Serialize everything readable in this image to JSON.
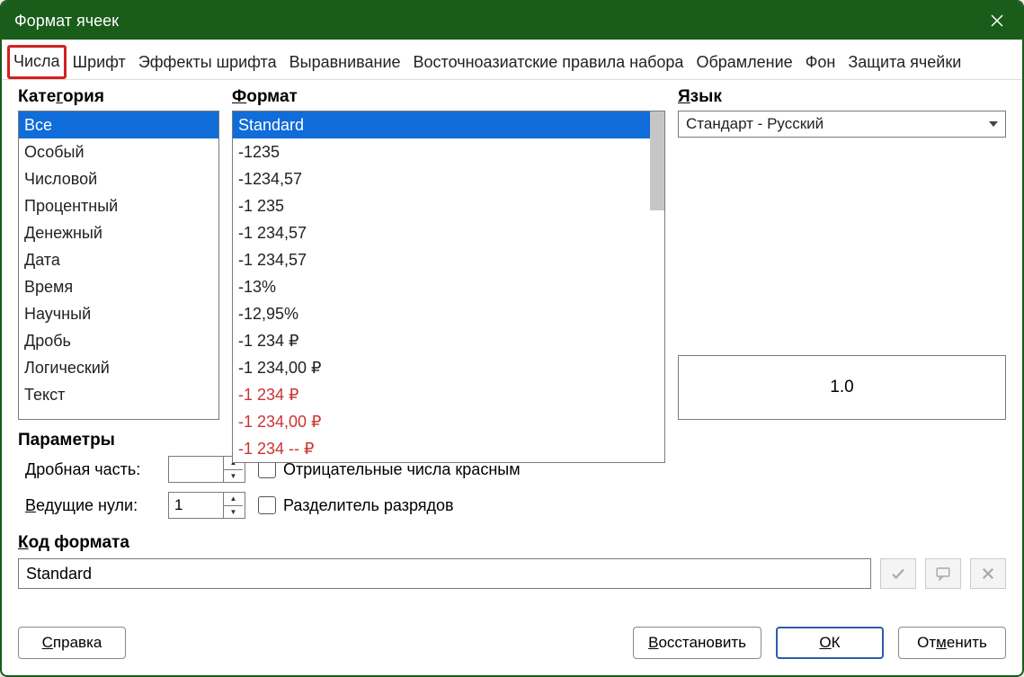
{
  "title": "Формат ячеек",
  "tabs": [
    "Числа",
    "Шрифт",
    "Эффекты шрифта",
    "Выравнивание",
    "Восточноазиатские правила набора",
    "Обрамление",
    "Фон",
    "Защита ячейки"
  ],
  "active_tab": 0,
  "labels": {
    "category": "Категория",
    "format": "Формат",
    "language": "Язык",
    "parameters": "Параметры",
    "decimal": "Дробная часть:",
    "leading": "Ведущие нули:",
    "neg_red": "Отрицательные числа красным",
    "thou_sep": "Разделитель разрядов",
    "format_code": "Код формата"
  },
  "categories": [
    "Все",
    "Особый",
    "Числовой",
    "Процентный",
    "Денежный",
    "Дата",
    "Время",
    "Научный",
    "Дробь",
    "Логический",
    "Текст"
  ],
  "category_selected": 0,
  "formats": [
    {
      "text": "Standard",
      "red": false
    },
    {
      "text": "-1235",
      "red": false
    },
    {
      "text": "-1234,57",
      "red": false
    },
    {
      "text": "-1 235",
      "red": false
    },
    {
      "text": "-1 234,57",
      "red": false
    },
    {
      "text": "-1 234,57",
      "red": false
    },
    {
      "text": "-13%",
      "red": false
    },
    {
      "text": "-12,95%",
      "red": false
    },
    {
      "text": "-1 234 ₽",
      "red": false
    },
    {
      "text": "-1 234,00 ₽",
      "red": false
    },
    {
      "text": "-1 234 ₽",
      "red": true
    },
    {
      "text": "-1 234,00 ₽",
      "red": true
    },
    {
      "text": "-1 234 -- ₽",
      "red": true
    }
  ],
  "format_selected": 0,
  "language_value": "Стандарт - Русский",
  "preview_value": "1.0",
  "decimal_value": "",
  "leading_value": "1",
  "neg_red_checked": false,
  "thou_sep_checked": false,
  "format_code_value": "Standard",
  "buttons": {
    "help": "Справка",
    "restore": "Восстановить",
    "ok": "ОК",
    "cancel": "Отменить"
  }
}
